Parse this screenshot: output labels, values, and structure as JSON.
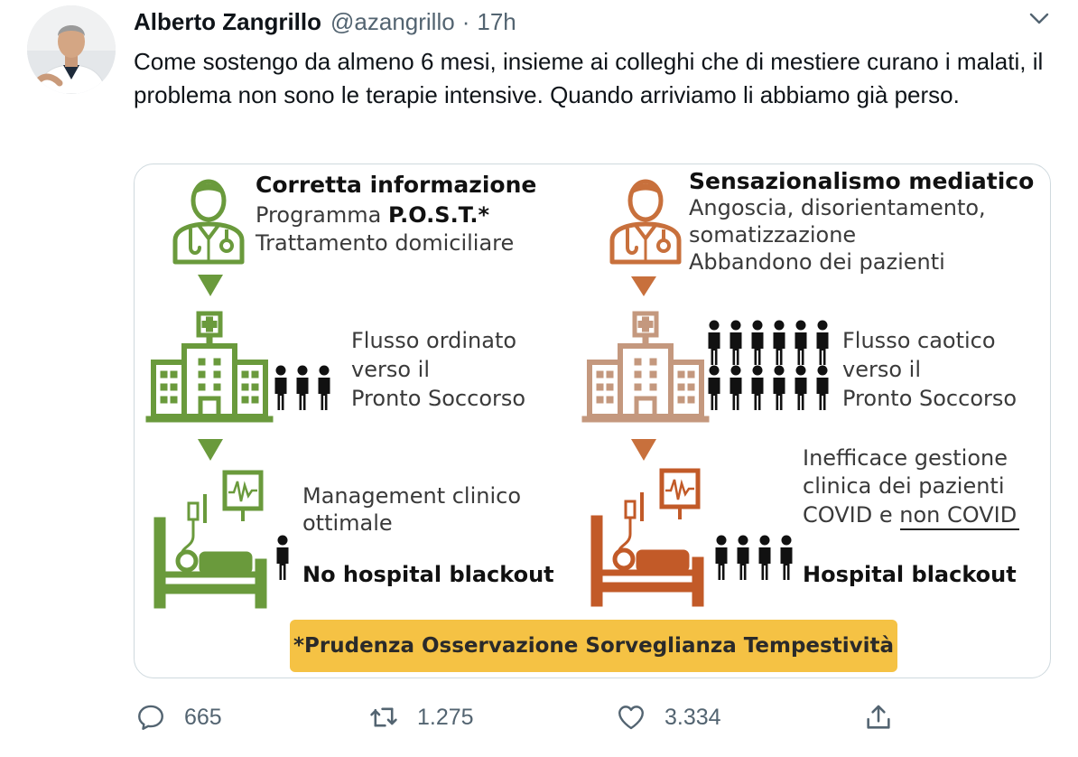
{
  "tweet": {
    "author_name": "Alberto Zangrillo",
    "handle": "@azangrillo",
    "separator": "·",
    "time": "17h",
    "text": "Come sostengo da almeno 6 mesi, insieme ai colleghi che di mestiere curano i malati, il problema non sono le terapie intensive. Quando arriviamo li abbiamo già perso."
  },
  "infographic": {
    "left": {
      "title": "Corretta informazione",
      "line1_prefix": "Programma ",
      "line1_bold": "P.O.S.T.*",
      "line2": "Trattamento domiciliare",
      "flow_line1": "Flusso ordinato",
      "flow_line2": "verso il",
      "flow_line3": "Pronto Soccorso",
      "mgmt_line1": "Management clinico",
      "mgmt_line2": "ottimale",
      "result": "No hospital blackout",
      "color": "#6a9a3c"
    },
    "right": {
      "title": "Sensazionalismo mediatico",
      "line1": "Angoscia, disorientamento,",
      "line2": "somatizzazione",
      "line3": "Abbandono dei pazienti",
      "flow_line1": "Flusso caotico",
      "flow_line2": "verso il",
      "flow_line3": "Pronto Soccorso",
      "mgmt_line1": "Inefficace gestione",
      "mgmt_line2": "clinica dei pazienti",
      "mgmt_line3_prefix": "COVID e ",
      "mgmt_line3_underlined": "non COVID",
      "result": "Hospital blackout",
      "color_doctor": "#c8703c",
      "color_hospital": "#c4987e",
      "color_bed": "#c25a28"
    },
    "footnote": "*Prudenza Osservazione Sorveglianza Tempestività",
    "footnote_color": "#f5c244"
  },
  "actions": {
    "reply_count": "665",
    "retweet_count": "1.275",
    "like_count": "3.334",
    "icons": [
      "reply-icon",
      "retweet-icon",
      "like-icon",
      "share-icon"
    ]
  }
}
